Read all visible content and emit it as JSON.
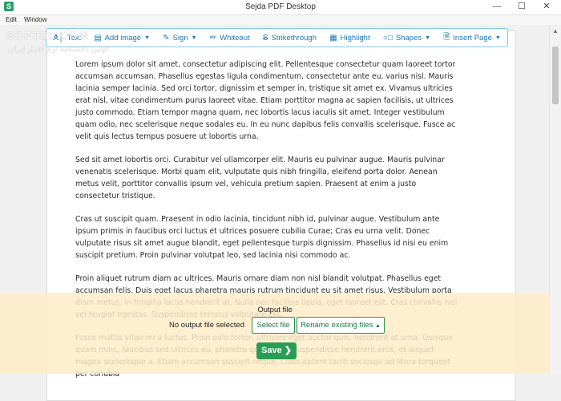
{
  "window": {
    "title": "Sejda PDF Desktop",
    "icon_letter": "S"
  },
  "menu": [
    "Edit",
    "Window"
  ],
  "toolbar": [
    {
      "label": "Text",
      "icon": "text-cursor-icon",
      "dropdown": false
    },
    {
      "label": "Add image",
      "icon": "image-icon",
      "dropdown": true
    },
    {
      "label": "Sign",
      "icon": "pen-icon",
      "dropdown": true
    },
    {
      "label": "Whiteout",
      "icon": "brush-icon",
      "dropdown": false
    },
    {
      "label": "Strikethrough",
      "icon": "strikethrough-icon",
      "dropdown": false
    },
    {
      "label": "Highlight",
      "icon": "highlighter-icon",
      "dropdown": false
    },
    {
      "label": "Shapes",
      "icon": "shapes-icon",
      "dropdown": true
    },
    {
      "label": "Insert Page",
      "icon": "page-icon",
      "dropdown": true
    }
  ],
  "watermark": {
    "brand": "SOFTDL.COM",
    "tagline": "اولین دانشنامه نرم افزار ایران"
  },
  "document": {
    "paragraphs": [
      "Lorem ipsum dolor sit amet, consectetur adipiscing elit. Pellentesque consectetur quam laoreet tortor accumsan accumsan. Phasellus egestas ligula condimentum, consectetur ante eu, varius nisl. Mauris lacinia semper lacinia. Sed orci tortor, dignissim et semper in, tristique sit amet ex. Vivamus ultricies erat nisl, vitae condimentum purus laoreet vitae. Etiam porttitor magna ac sapien facilisis, ut ultrices justo commodo. Etiam tempor magna quam, nec lobortis lacus iaculis sit amet. Integer vestibulum quam odio, nec scelerisque neque sodales eu. In eu nunc dapibus felis convallis scelerisque. Fusce ac velit quis lectus tempus posuere ut lobortis urna.",
      "Sed sit amet lobortis orci. Curabitur vel ullamcorper elit. Mauris eu pulvinar augue. Mauris pulvinar venenatis scelerisque. Morbi quam elit, vulputate quis nibh fringilla, eleifend porta dolor. Aenean metus velit, porttitor convallis ipsum vel, vehicula pretium sapien. Praesent at enim a justo consectetur tristique.",
      "Cras ut suscipit quam. Praesent in odio lacinia, tincidunt nibh id, pulvinar augue. Vestibulum ante ipsum primis in faucibus orci luctus et ultrices posuere cubilia Curae; Cras eu urna velit. Donec vulputate risus sit amet augue blandit, eget pellentesque turpis dignissim. Phasellus id nisi eu enim suscipit pretium. Proin pulvinar volutpat leo, sed lacinia nisi commodo ac.",
      "Proin aliquet rutrum diam ac ultrices. Mauris ornare diam non nisl blandit volutpat. Phasellus eget accumsan felis. Duis eget lacus pharetra mauris rutrum tincidunt eu sit amet risus. Vestibulum porta diam metus, in fringilla lacus hendrerit at. Nulla nec facilisis ligula, eget laoreet elit. Cras convallis nisl vel feugiat egestas. Suspendisse tempus vulputate elit.",
      "Fusce mattis vitae mi a luctus. Proin odio tortor, ultricies eget auctor quis, hendrerit at urna. Quisque quam nunc, faucibus sed ultrices eu, pharetra quis tellus. Suspendisse hendrerit eros, et aliquet magna scelerisque a. Etiam accumsan suscipit neque. Class aptent taciti sociosqu ad litora torquent per conubia"
    ]
  },
  "output": {
    "title": "Output file",
    "status": "No output file selected",
    "select_label": "Select file",
    "rename_label": "Rename existing files",
    "save_label": "Save"
  },
  "colors": {
    "accent": "#1a78b4",
    "save": "#2a9d55",
    "panel": "#ffecc8"
  }
}
